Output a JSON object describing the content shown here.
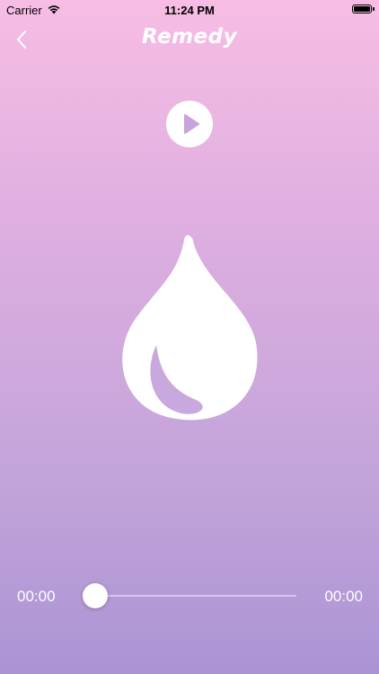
{
  "status_bar": {
    "carrier": "Carrier",
    "time": "11:24 PM",
    "wifi_icon": "wifi-icon",
    "battery_icon": "battery-icon",
    "battery_level": 1.0
  },
  "nav": {
    "title": "Remedy",
    "back_icon": "chevron-left-icon"
  },
  "player": {
    "play_icon": "play-icon",
    "artwork_icon": "water-drop-icon",
    "current_time": "00:00",
    "total_time": "00:00",
    "progress": 0
  },
  "colors": {
    "gradient_top": "#f7bde4",
    "gradient_bottom": "#ab94d4",
    "accent": "#ffffff",
    "play_triangle": "#c9a3dc",
    "drop_inner": "#c9a9dd"
  }
}
